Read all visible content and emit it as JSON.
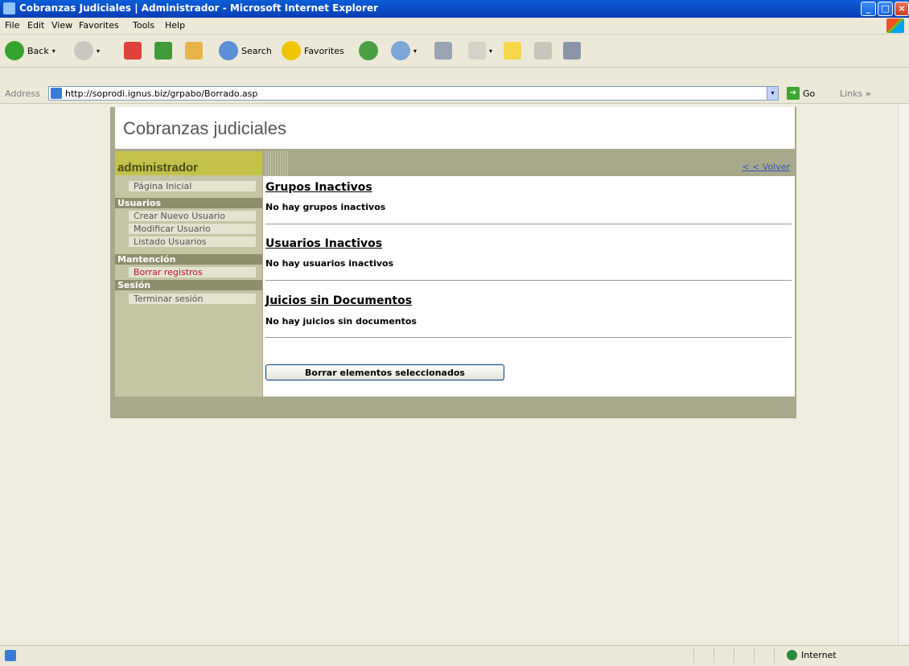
{
  "window": {
    "title": "Cobranzas Judiciales | Administrador - Microsoft Internet Explorer",
    "controls": {
      "minimize": "_",
      "maximize": "□",
      "close": "×"
    }
  },
  "menu": [
    "File",
    "Edit",
    "View",
    "Favorites",
    "Tools",
    "Help"
  ],
  "toolbar": {
    "back": "Back",
    "search": "Search",
    "favorites": "Favorites",
    "dropdown": "▾"
  },
  "address": {
    "label": "Address",
    "url": "http://soprodi.ignus.biz/grpabo/Borrado.asp",
    "go": "Go",
    "links": "Links",
    "links_more": "»"
  },
  "page": {
    "logo": "Cobranzas judiciales",
    "sidebar": {
      "title": "administrador",
      "home": "Página Inicial",
      "groups": [
        {
          "heading": "Usuarios",
          "items": [
            "Crear Nuevo Usuario",
            "Modificar Usuario",
            "Listado Usuarios"
          ]
        },
        {
          "heading": "Mantención",
          "items": [
            "Borrar registros"
          ]
        },
        {
          "heading": "Sesión",
          "items": [
            "Terminar sesión"
          ]
        }
      ]
    },
    "back_link": "< < Volver",
    "sections": [
      {
        "title": "Grupos Inactivos",
        "text": "No hay grupos inactivos"
      },
      {
        "title": "Usuarios Inactivos",
        "text": "No hay usuarios inactivos"
      },
      {
        "title": "Juicios sin Documentos",
        "text": "No hay juicios sin documentos"
      }
    ],
    "delete_button": "Borrar elementos seleccionados"
  },
  "status": {
    "zone": "Internet"
  },
  "colors": {
    "accent": "#c2c24a",
    "sidebar": "#c5c5a5",
    "frame": "#a8a88a",
    "active_link": "#c0102a",
    "link": "#3355bb"
  }
}
